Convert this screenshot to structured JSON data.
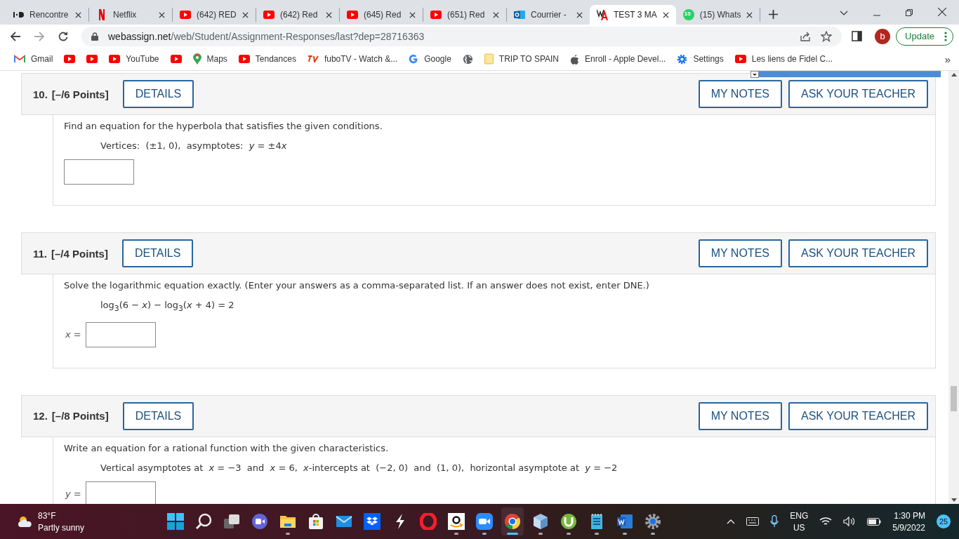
{
  "tabs": [
    {
      "kind": "id",
      "title": "Rencontre",
      "selected": false
    },
    {
      "kind": "netflix",
      "title": "Netflix",
      "selected": false
    },
    {
      "kind": "youtube",
      "title": "(642) RED",
      "selected": false
    },
    {
      "kind": "youtube",
      "title": "(642) Red",
      "selected": false
    },
    {
      "kind": "youtube",
      "title": "(645) Red",
      "selected": false
    },
    {
      "kind": "youtube",
      "title": "(651) Red",
      "selected": false
    },
    {
      "kind": "outlook",
      "title": "Courrier -",
      "selected": false
    },
    {
      "kind": "wa",
      "title": "TEST 3 MA",
      "selected": true
    },
    {
      "kind": "whatsapp",
      "title": "(15) Whats",
      "selected": false,
      "badge": "15"
    }
  ],
  "address_bar": {
    "host": "webassign.net",
    "path": "/web/Student/Assignment-Responses/last?dep=28716363"
  },
  "profile": "b",
  "update_button": "Update",
  "bookmarks": [
    {
      "kind": "gmail",
      "label": "Gmail"
    },
    {
      "kind": "youtube"
    },
    {
      "kind": "youtube"
    },
    {
      "kind": "youtube",
      "label": "YouTube"
    },
    {
      "kind": "youtube"
    },
    {
      "kind": "maps",
      "label": "Maps"
    },
    {
      "kind": "youtube",
      "label": "Tendances"
    },
    {
      "kind": "fubo",
      "label": "fuboTV - Watch &..."
    },
    {
      "kind": "google",
      "label": "Google"
    },
    {
      "kind": "globe"
    },
    {
      "kind": "folder",
      "label": "TRIP TO SPAIN"
    },
    {
      "kind": "apple",
      "label": "Enroll - Apple Devel..."
    },
    {
      "kind": "gear",
      "label": "Settings"
    },
    {
      "kind": "youtube",
      "label": "Les liens de Fidel C..."
    }
  ],
  "bookmarks_more": "»",
  "questions": [
    {
      "number": "10.",
      "points": "[–/6 Points]",
      "details": "DETAILS",
      "notes": "MY NOTES",
      "ask": "ASK YOUR TEACHER",
      "prompt": "Find an equation for the hyperbola that satisfies the given conditions.",
      "formula": [
        "Vertices:  (±1, 0),  asymptotes:  *y* = ±4",
        "*x*"
      ]
    },
    {
      "number": "11.",
      "points": "[–/4 Points]",
      "details": "DETAILS",
      "notes": "MY NOTES",
      "ask": "ASK YOUR TEACHER",
      "prompt": "Solve the logarithmic equation exactly. (Enter your answers as a comma-separated list. If an answer does not exist, enter DNE.)",
      "formula": [
        "log$_{3}$(6 − *x*) − log$_{3}$(*x* + 4) = 2"
      ],
      "answer_label": "*x* ="
    },
    {
      "number": "12.",
      "points": "[–/8 Points]",
      "details": "DETAILS",
      "notes": "MY NOTES",
      "ask": "ASK YOUR TEACHER",
      "prompt": "Write an equation for a rational function with the given characteristics.",
      "formula": [
        "Vertical asymptotes at  *x* = −3  and  *x* = 6,  *x*-intercepts at  (−2, 0)  and  (1, 0),  horizontal asymptote at  *y* = −2"
      ],
      "answer_label": "*y* ="
    }
  ],
  "taskbar": {
    "weather": {
      "temperature": "83°F",
      "condition": "Partly sunny"
    },
    "apps": [
      {
        "kind": "start",
        "running": false,
        "selected": false
      },
      {
        "kind": "search",
        "running": false,
        "selected": false
      },
      {
        "kind": "taskview",
        "running": false,
        "selected": false
      },
      {
        "kind": "chat",
        "running": false,
        "selected": false
      },
      {
        "kind": "folder",
        "running": true,
        "selected": false
      },
      {
        "kind": "store",
        "running": false,
        "selected": false
      },
      {
        "kind": "mail",
        "running": false,
        "selected": false
      },
      {
        "kind": "dropbox",
        "running": false,
        "selected": false
      },
      {
        "kind": "bolt",
        "running": false,
        "selected": false
      },
      {
        "kind": "opera",
        "running": false,
        "selected": false
      },
      {
        "kind": "amazon",
        "running": true,
        "selected": false
      },
      {
        "kind": "zoom",
        "running": true,
        "selected": false
      },
      {
        "kind": "chrome",
        "running": true,
        "selected": true
      },
      {
        "kind": "cube",
        "running": true,
        "selected": false
      },
      {
        "kind": "torrent",
        "running": true,
        "selected": false
      },
      {
        "kind": "notepad",
        "running": true,
        "selected": false
      },
      {
        "kind": "word",
        "running": true,
        "selected": false
      },
      {
        "kind": "settings",
        "running": true,
        "selected": false
      }
    ],
    "language": "ENG",
    "region": "US",
    "time": "1:30 PM",
    "date": "5/9/2022",
    "notifications": "25"
  }
}
